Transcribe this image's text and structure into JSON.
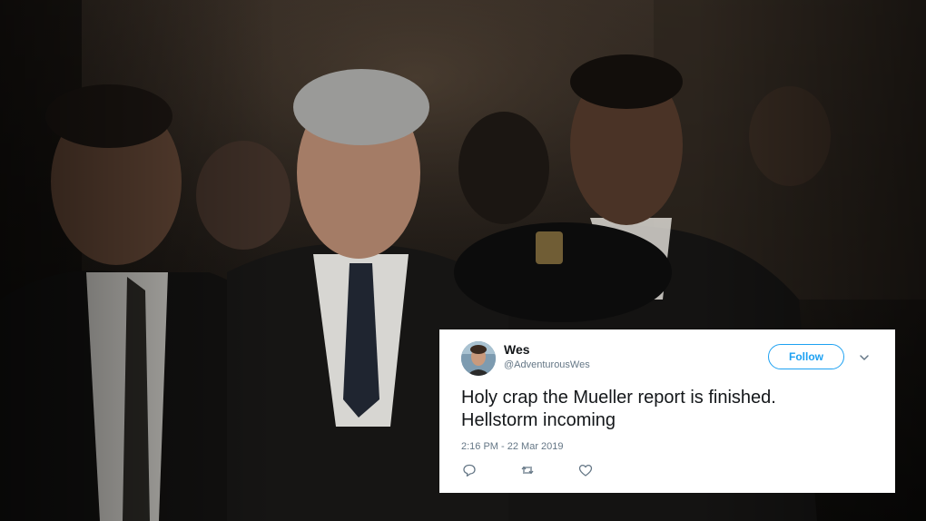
{
  "tweet": {
    "author_name": "Wes",
    "handle": "@AdventurousWes",
    "follow_label": "Follow",
    "text_line1": "Holy crap the Mueller report is finished.",
    "text_line2": "Hellstorm incoming",
    "timestamp": "2:16 PM - 22 Mar 2019"
  },
  "icons": {
    "reply": "reply-icon",
    "retweet": "retweet-icon",
    "like": "like-icon",
    "menu": "chevron-down-icon"
  },
  "colors": {
    "accent": "#1da1f2",
    "text": "#14171a",
    "muted": "#657786",
    "card_background": "#ffffff"
  }
}
